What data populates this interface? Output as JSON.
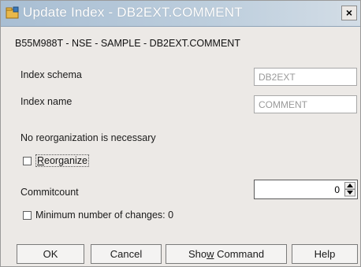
{
  "window": {
    "title": "Update Index - DB2EXT.COMMENT",
    "close_label": "×"
  },
  "context_path": "B55M988T - NSE - SAMPLE - DB2EXT.COMMENT",
  "form": {
    "index_schema": {
      "label": "Index schema",
      "value": "DB2EXT"
    },
    "index_name": {
      "label": "Index name",
      "value": "COMMENT"
    },
    "reorg_message": "No reorganization is necessary",
    "reorganize": {
      "label_prefix": "",
      "mnemonic": "R",
      "label_rest": "eorganize",
      "checked": false
    },
    "commitcount": {
      "label": "Commitcount",
      "value": "0"
    },
    "min_changes": {
      "label": "Minimum number of changes: 0",
      "checked": false
    }
  },
  "buttons": {
    "ok": "OK",
    "cancel": "Cancel",
    "show_command_prefix": "Sho",
    "show_command_mnemonic": "w",
    "show_command_rest": " Command",
    "help": "Help"
  },
  "colors": {
    "titlebar": "#bdcedd",
    "window_bg": "#ece9e6",
    "disabled_text": "#9a9a9a"
  }
}
